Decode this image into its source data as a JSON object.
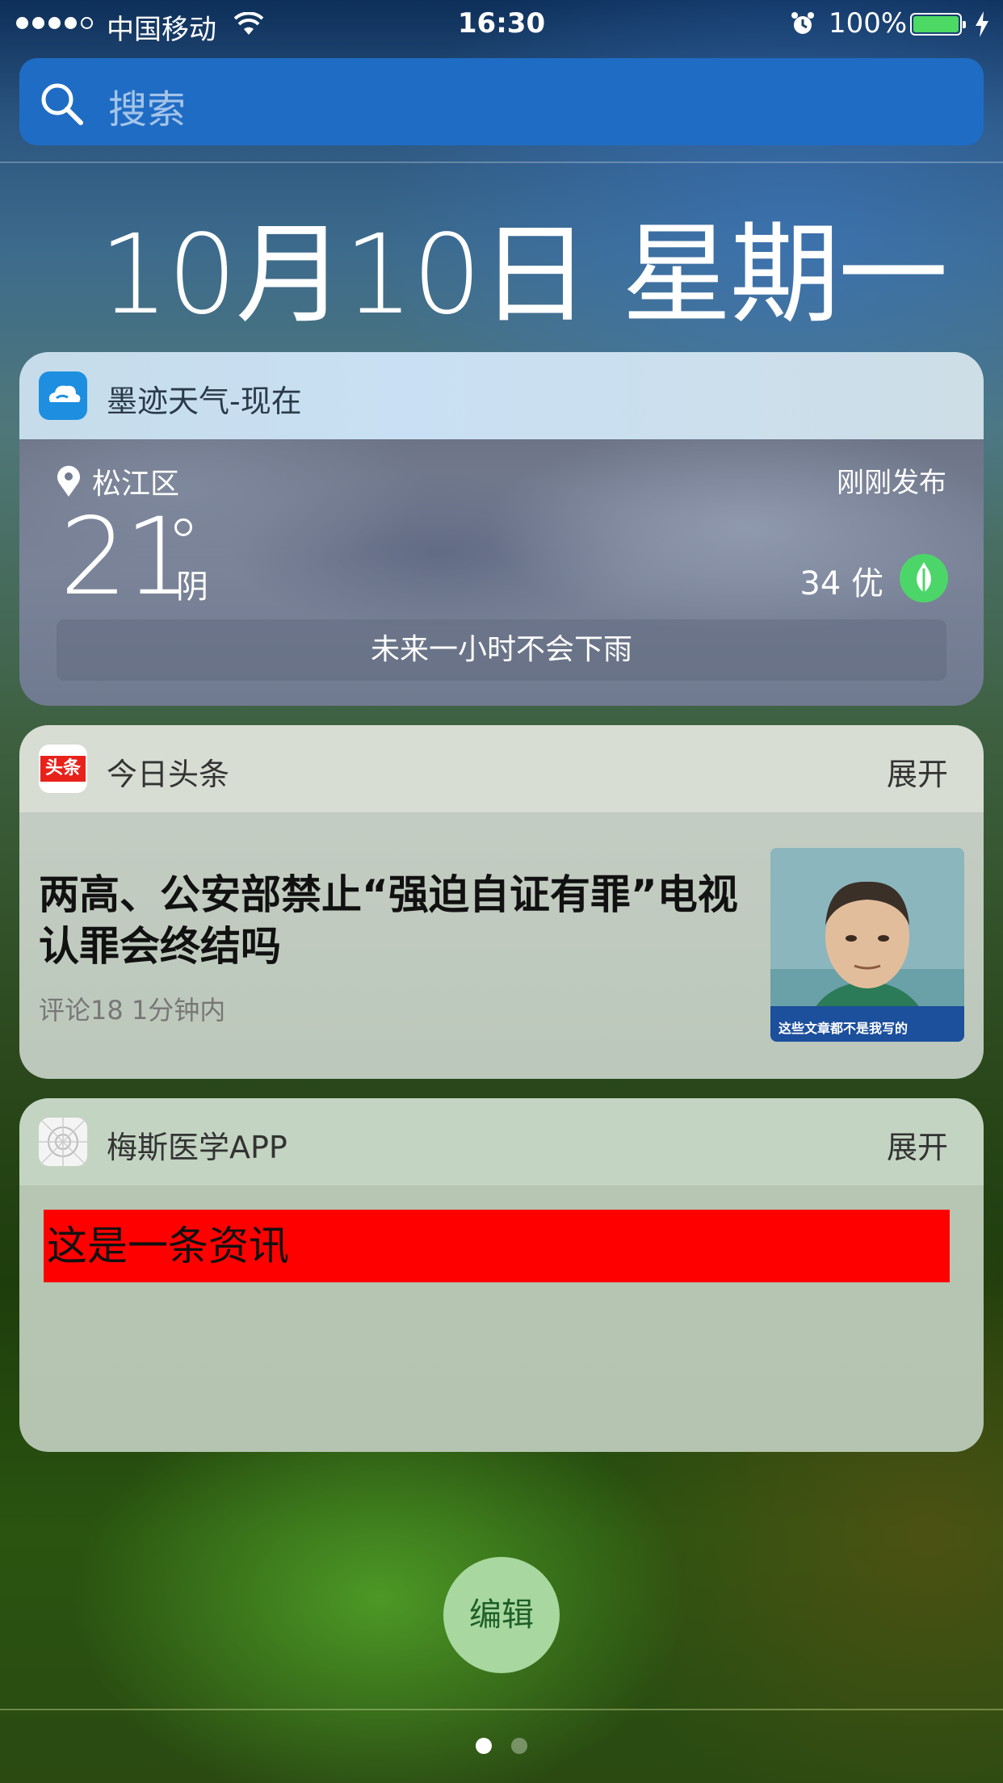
{
  "status_bar": {
    "carrier": "中国移动",
    "time": "16:30",
    "battery_percent": "100%",
    "signal_bars": 4,
    "signal_total": 5,
    "wifi_icon": "wifi-icon",
    "alarm_icon": "alarm-clock-icon",
    "charging_icon": "bolt-icon",
    "battery_color": "#4cd964"
  },
  "search": {
    "placeholder": "搜索",
    "icon": "search-icon"
  },
  "date_heading": "10月10日 星期一",
  "weather_widget": {
    "app_name": "墨迹天气-现在",
    "location": "松江区",
    "published": "刚刚发布",
    "temperature": "21",
    "condition": "阴",
    "aqi": "34 优",
    "rain_forecast": "未来一小时不会下雨",
    "aqi_badge_color": "#4cd66a"
  },
  "news_widget": {
    "app_name": "今日头条",
    "app_icon_text": "头条",
    "expand_label": "展开",
    "headline": "两高、公安部禁止“强迫自证有罪”电视认罪会终结吗",
    "meta": "评论18  1分钟内",
    "thumbnail_caption": "这些文章都不是我写的"
  },
  "meds_widget": {
    "app_name": "梅斯医学APP",
    "expand_label": "展开",
    "banner_text": "这是一条资讯",
    "banner_color": "#ff0000"
  },
  "edit_button": "编辑",
  "page_indicator": {
    "current": 1,
    "total": 2
  }
}
